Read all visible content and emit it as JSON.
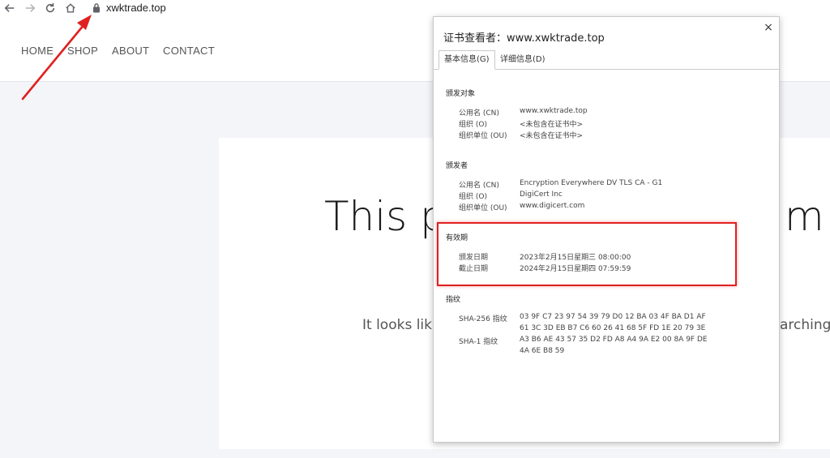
{
  "browser": {
    "url": "xwktrade.top"
  },
  "site_nav": {
    "home": "HOME",
    "shop": "SHOP",
    "about": "ABOUT",
    "contact": "CONTACT"
  },
  "page": {
    "title_left": "This p",
    "title_right": "m",
    "subtitle_left": "It looks lik",
    "subtitle_right": "arching"
  },
  "cert_dialog": {
    "title": "证书查看者：www.xwktrade.top",
    "close": "×",
    "tabs": {
      "general": "基本信息(G)",
      "details": "详细信息(D)"
    },
    "issued_to": {
      "heading": "颁发对象",
      "cn_label": "公用名 (CN)",
      "cn_value": "www.xwktrade.top",
      "o_label": "组织 (O)",
      "o_value": "<未包含在证书中>",
      "ou_label": "组织单位 (OU)",
      "ou_value": "<未包含在证书中>"
    },
    "issued_by": {
      "heading": "颁发者",
      "cn_label": "公用名 (CN)",
      "cn_value": "Encryption Everywhere DV TLS CA - G1",
      "o_label": "组织 (O)",
      "o_value": "DigiCert Inc",
      "ou_label": "组织单位 (OU)",
      "ou_value": "www.digicert.com"
    },
    "validity": {
      "heading": "有效期",
      "issued_label": "颁发日期",
      "issued_value": "2023年2月15日星期三 08:00:00",
      "expires_label": "截止日期",
      "expires_value": "2024年2月15日星期四 07:59:59"
    },
    "fingerprints": {
      "heading": "指纹",
      "sha256_label": "SHA-256 指纹",
      "sha256_line1": "03 9F C7 23 97 54 39 79 D0 12 BA 03 4F BA D1 AF",
      "sha256_line2": "61 3C 3D EB B7 C6 60 26 41 68 5F FD 1E 20 79 3E",
      "sha1_label": "SHA-1 指纹",
      "sha1_line1": "A3 B6 AE 43 57 35 D2 FD A8 A4 9A E2 00 8A 9F DE",
      "sha1_line2": "4A 6E B8 59"
    }
  },
  "colors": {
    "highlight": "#e02020",
    "arrow": "#e02020"
  }
}
